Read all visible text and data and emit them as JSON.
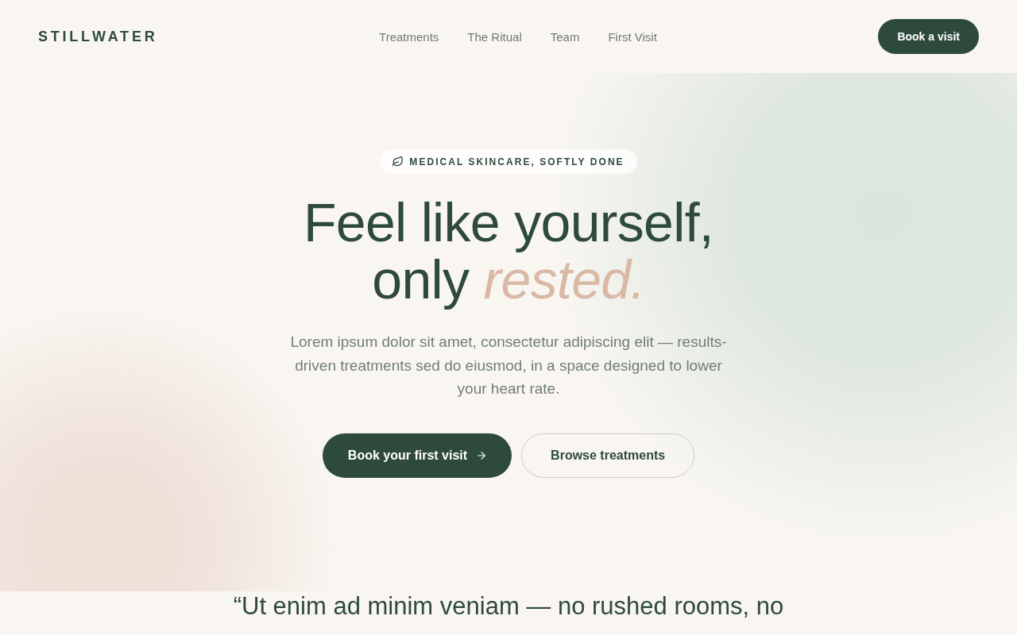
{
  "header": {
    "logo": "STILLWATER",
    "nav": [
      "Treatments",
      "The Ritual",
      "Team",
      "First Visit"
    ],
    "button": "Book a visit"
  },
  "hero": {
    "badge": "MEDICAL SKINCARE, SOFTLY DONE",
    "headline": "Feel like yourself, only *rested.*",
    "intro": "Lorem ipsum dolor sit amet, consectetur adipiscing elit — results-driven treatments sed do eiusmod, in a space designed to lower your heart rate.",
    "buttons": [
      {
        "label": "Book your first visit",
        "kind": "primary"
      },
      {
        "label": "Browse treatments",
        "kind": "secondary"
      }
    ]
  },
  "quote": {
    "text": "“Ut enim ad minim veniam — no rushed rooms, no"
  }
}
